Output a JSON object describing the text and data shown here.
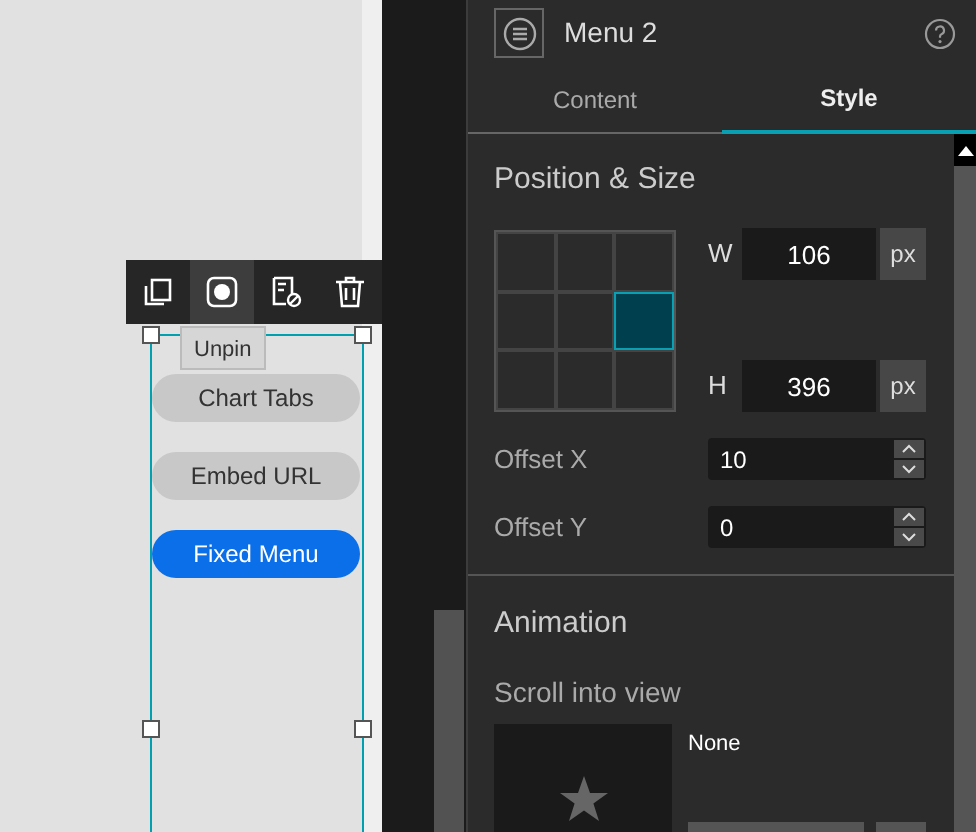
{
  "canvas": {
    "toolbar": [
      {
        "kind": "copy",
        "selected": false
      },
      {
        "kind": "record",
        "selected": true
      },
      {
        "kind": "hide",
        "selected": false
      },
      {
        "kind": "delete",
        "selected": false
      }
    ],
    "tooltip": "Unpin",
    "menu_items": [
      {
        "label": "Chart Tabs",
        "selected": false
      },
      {
        "label": "Embed URL",
        "selected": false
      },
      {
        "label": "Fixed Menu",
        "selected": true
      }
    ]
  },
  "panel": {
    "title": "Menu 2",
    "tabs": [
      {
        "label": "Content",
        "selected": false
      },
      {
        "label": "Style",
        "selected": true
      }
    ],
    "position_size": {
      "heading": "Position & Size",
      "anchor_cells": [
        {
          "selected": false
        },
        {
          "selected": false
        },
        {
          "selected": false
        },
        {
          "selected": false
        },
        {
          "selected": false
        },
        {
          "selected": true
        },
        {
          "selected": false
        },
        {
          "selected": false
        },
        {
          "selected": false
        }
      ],
      "width": {
        "label": "W",
        "value": "106",
        "unit": "px"
      },
      "height": {
        "label": "H",
        "value": "396",
        "unit": "px"
      },
      "offset_x": {
        "label": "Offset X",
        "value": "10"
      },
      "offset_y": {
        "label": "Offset Y",
        "value": "0"
      }
    },
    "animation": {
      "heading": "Animation",
      "subheading": "Scroll into view",
      "effect": "None"
    }
  }
}
